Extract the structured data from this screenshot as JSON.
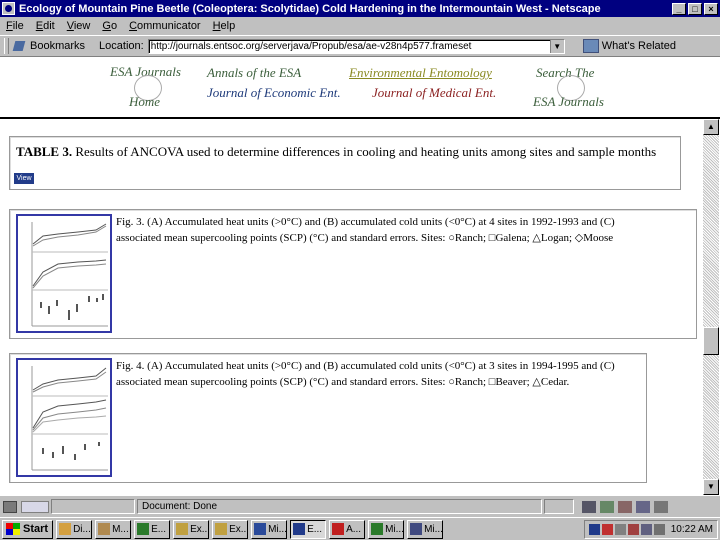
{
  "window": {
    "title": "Ecology of Mountain Pine Beetle (Coleoptera: Scolytidae) Cold Hardening in the Intermountain West - Netscape",
    "buttons": [
      "_",
      "□",
      "×"
    ]
  },
  "menu": [
    "File",
    "Edit",
    "View",
    "Go",
    "Communicator",
    "Help"
  ],
  "location_bar": {
    "bookmarks_label": "Bookmarks",
    "location_label": "Location:",
    "url": "http://journals.entsoc.org/serverjava/Propub/esa/ae-v28n4p577.frameset",
    "whats_related_label": "What's Related"
  },
  "banner": {
    "links": [
      {
        "label": "ESA Journals",
        "color": "#3b5e3b"
      },
      {
        "label": "Home",
        "color": "#3b5e3b"
      },
      {
        "label": "Annals of the ESA",
        "color": "#3b5e3b"
      },
      {
        "label": "Journal of Economic Ent.",
        "color": "#1e3a7a"
      },
      {
        "label": "Environmental Entomology",
        "color": "#8a8a22"
      },
      {
        "label": "Journal of Medical Ent.",
        "color": "#8a1f1f"
      },
      {
        "label": "Search The",
        "color": "#3b5e3b"
      },
      {
        "label": "ESA Journals",
        "color": "#3b5e3b"
      }
    ]
  },
  "table3": {
    "label": "TABLE 3.",
    "text": "Results of ANCOVA used to determine differences in cooling and heating units among sites and sample months",
    "view_button": "View"
  },
  "figures": [
    {
      "caption_line1": "Fig. 3. (A) Accumulated heat units (>0°C) and (B) accumulated cold units (<0°C) at 4 sites in 1992-1993 and (C)",
      "caption_line2_prefix": "associated mean supercooling points (SCP) (°C) and standard errors. Sites:",
      "sites": [
        "Ranch;",
        "Galena;",
        "Logan;",
        "Moose"
      ]
    },
    {
      "caption_line1": "Fig. 4. (A) Accumulated heat units (>0°C) and (B) accumulated cold units (<0°C) at 3 sites in 1994-1995 and (C)",
      "caption_line2_prefix": "associated mean supercooling points (SCP) (°C) and standard errors. Sites:",
      "sites": [
        "Ranch;",
        "Beaver;",
        "Cedar."
      ]
    }
  ],
  "status": {
    "document_status": "Document: Done"
  },
  "taskbar": {
    "start_label": "Start",
    "tasks": [
      "Di...",
      "M...",
      "E...",
      "Ex...",
      "Ex...",
      "Mi...",
      "E...",
      "A...",
      "Mi...",
      "Mi..."
    ],
    "active_task_index": 6,
    "clock": "10:22 AM"
  }
}
